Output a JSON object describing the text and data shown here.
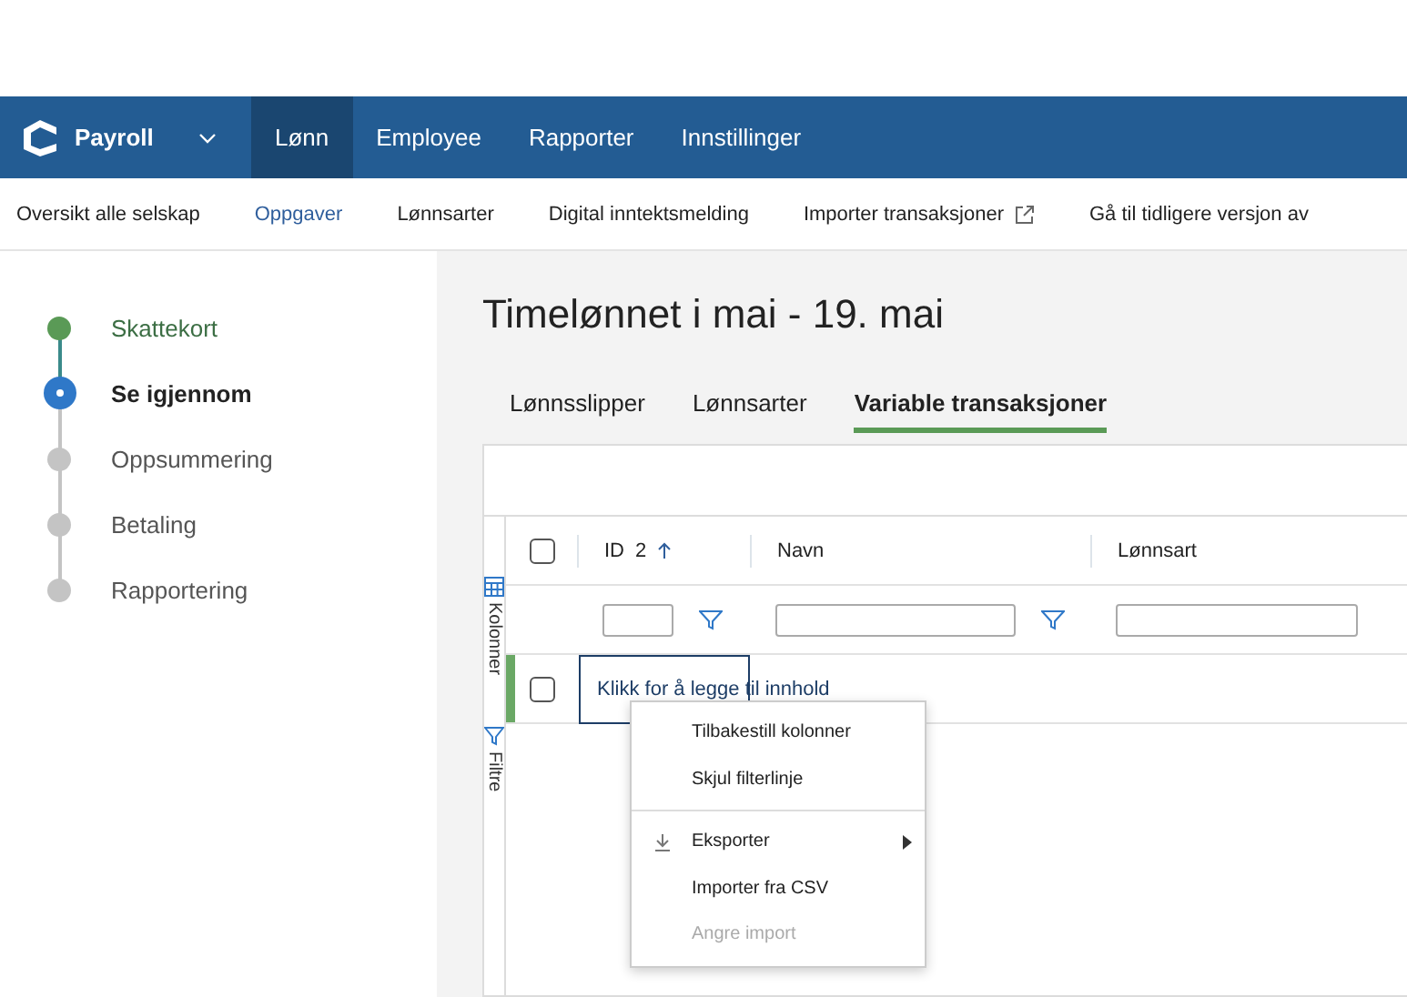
{
  "app": {
    "name": "Payroll"
  },
  "nav": [
    {
      "label": "Lønn",
      "selected": true
    },
    {
      "label": "Employee",
      "selected": false
    },
    {
      "label": "Rapporter",
      "selected": false
    },
    {
      "label": "Innstillinger",
      "selected": false
    }
  ],
  "subnav": [
    {
      "label": "Oversikt alle selskap",
      "selected": false,
      "kind": "link"
    },
    {
      "label": "Oppgaver",
      "selected": true,
      "kind": "link"
    },
    {
      "label": "Lønnsarter",
      "selected": false,
      "kind": "link"
    },
    {
      "label": "Digital inntektsmelding",
      "selected": false,
      "kind": "link"
    },
    {
      "label": "Importer transaksjoner",
      "selected": false,
      "kind": "external"
    },
    {
      "label": "Gå til tidligere versjon av",
      "selected": false,
      "kind": "link"
    }
  ],
  "steps": [
    {
      "label": "Skattekort",
      "done": true,
      "current": false
    },
    {
      "label": "Se igjennom",
      "done": false,
      "current": true
    },
    {
      "label": "Oppsummering",
      "done": false,
      "current": false
    },
    {
      "label": "Betaling",
      "done": false,
      "current": false
    },
    {
      "label": "Rapportering",
      "done": false,
      "current": false
    }
  ],
  "page_title": "Timelønnet i mai - 19. mai",
  "tabs": [
    {
      "label": "Lønnsslipper",
      "selected": false
    },
    {
      "label": "Lønnsarter",
      "selected": false
    },
    {
      "label": "Variable transaksjoner",
      "selected": true
    }
  ],
  "grid": {
    "side_panel": [
      "Kolonner",
      "Filtre"
    ],
    "columns": [
      {
        "label": "ID",
        "sort_index": "2",
        "sort_ascending": true,
        "filter": true
      },
      {
        "label": "Navn",
        "filter": true
      },
      {
        "label": "Lønnsart",
        "filter": false
      }
    ],
    "header_checked": false,
    "rows": [
      {
        "checked": false,
        "text": "Klikk for å legge til innhold"
      }
    ]
  },
  "context_menu": [
    [
      {
        "label": "Tilbakestill kolonner",
        "kind": "action",
        "disabled": false
      },
      {
        "label": "Skjul filterlinje",
        "kind": "action",
        "disabled": false
      }
    ],
    [
      {
        "label": "Eksporter",
        "kind": "submenu",
        "disabled": false
      },
      {
        "label": "Importer fra CSV",
        "kind": "action",
        "disabled": false
      },
      {
        "label": "Angre import",
        "kind": "action",
        "disabled": true
      }
    ]
  ]
}
